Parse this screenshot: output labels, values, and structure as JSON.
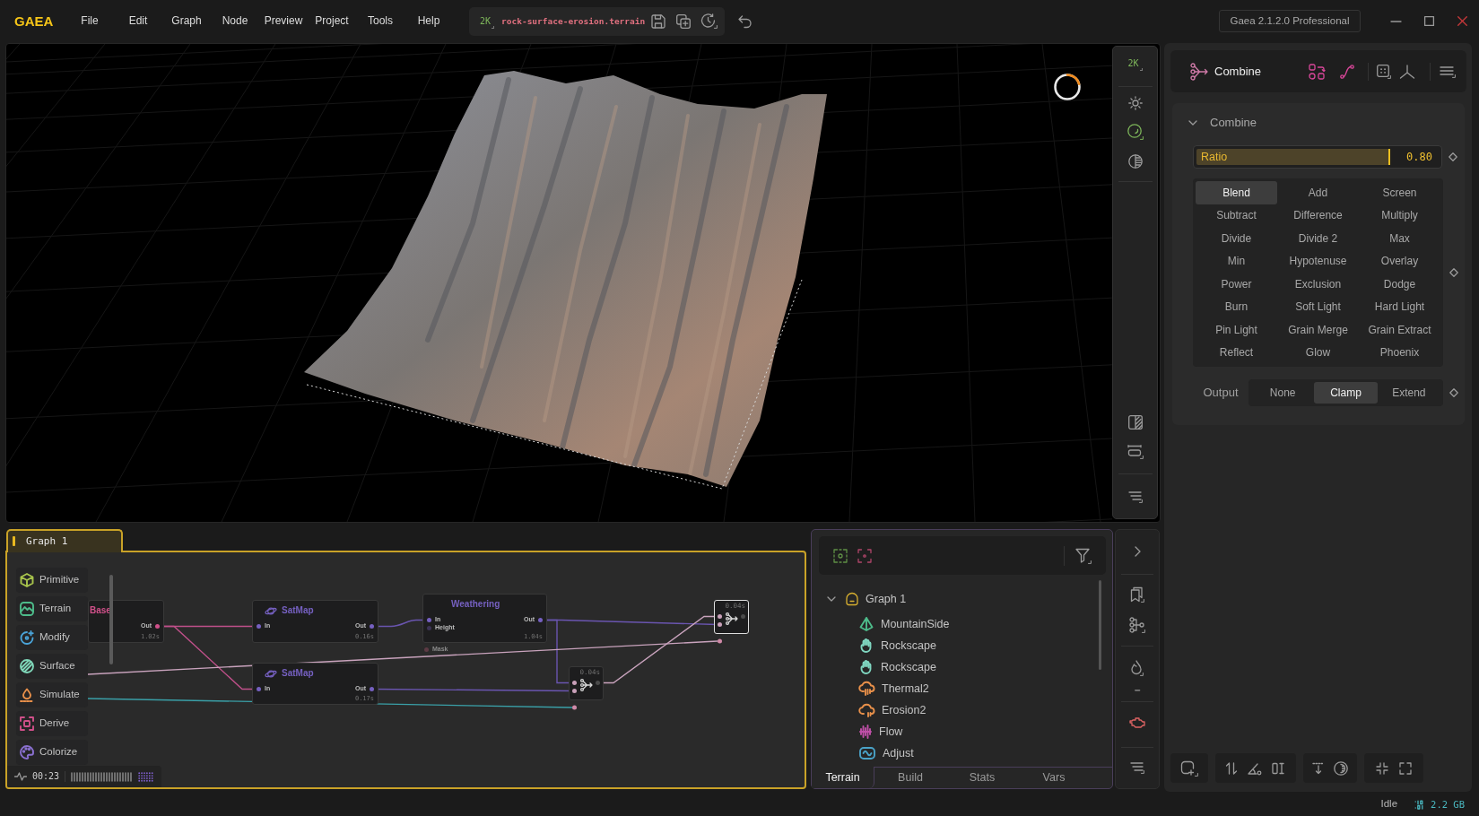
{
  "app": {
    "logo": "GAEA",
    "menu": [
      "File",
      "Edit",
      "Graph",
      "Node",
      "Preview",
      "Project",
      "Tools",
      "Help"
    ],
    "file": {
      "resolution": "2K",
      "name": "rock-surface-erosion.terrain"
    },
    "version": "Gaea 2.1.2.0 Professional"
  },
  "viewport": {
    "resolution": "2K",
    "toggles": [
      {
        "on": false
      },
      {
        "on": true
      },
      {
        "on": false
      }
    ]
  },
  "graph": {
    "tab": "Graph 1",
    "categories": [
      {
        "kind": "primitive",
        "label": "Primitive",
        "color": "#a8c44c"
      },
      {
        "kind": "terrain",
        "label": "Terrain",
        "color": "#4dbb8a"
      },
      {
        "kind": "modify",
        "label": "Modify",
        "color": "#4aa3d8"
      },
      {
        "kind": "surface",
        "label": "Surface",
        "color": "#7fd6b8"
      },
      {
        "kind": "simulate",
        "label": "Simulate",
        "color": "#e8904a"
      },
      {
        "kind": "derive",
        "label": "Derive",
        "color": "#d0508a"
      },
      {
        "kind": "colorize",
        "label": "Colorize",
        "color": "#8a70d0"
      }
    ],
    "nodes": [
      {
        "kind": "texture",
        "title": "Base",
        "color": "#d0508a",
        "outputs": [
          "Out"
        ],
        "time": "1.02s",
        "selected": false
      },
      {
        "kind": "satmap",
        "title": "SatMap",
        "color": "#7560c0",
        "inputs": [
          "In"
        ],
        "outputs": [
          "Out"
        ],
        "time": "0.16s",
        "selected": false
      },
      {
        "kind": "satmap",
        "title": "SatMap",
        "color": "#7560c0",
        "inputs": [
          "In"
        ],
        "outputs": [
          "Out"
        ],
        "time": "0.17s",
        "selected": false
      },
      {
        "kind": "weathering",
        "title": "Weathering",
        "color": "#7560c0",
        "inputs": [
          "In",
          "Height"
        ],
        "outputs": [
          "Out"
        ],
        "mask": "Mask",
        "time": "1.04s",
        "selected": false
      },
      {
        "kind": "combine",
        "time": "0.04s",
        "selected": false
      },
      {
        "kind": "combine",
        "time": "0.04s",
        "selected": true
      }
    ],
    "timer": "00:23"
  },
  "outline": {
    "tree": [
      {
        "label": "Graph 1",
        "expanded": true,
        "children": [
          {
            "kind": "mountainside",
            "label": "MountainSide",
            "color": "#4dbb8a"
          },
          {
            "kind": "rockscape",
            "label": "Rockscape",
            "color": "#7fd6c0"
          },
          {
            "kind": "rockscape",
            "label": "Rockscape",
            "color": "#7fd6c0"
          },
          {
            "kind": "thermal",
            "label": "Thermal2",
            "color": "#e8904a"
          },
          {
            "kind": "erosion",
            "label": "Erosion2",
            "color": "#e8904a"
          },
          {
            "kind": "flow",
            "label": "Flow",
            "color": "#c050a8"
          },
          {
            "kind": "adjust",
            "label": "Adjust",
            "color": "#4aa3c8"
          }
        ]
      }
    ],
    "tabs": [
      {
        "label": "Terrain",
        "selected": true
      },
      {
        "label": "Build",
        "selected": false
      },
      {
        "label": "Stats",
        "selected": false
      },
      {
        "label": "Vars",
        "selected": false
      }
    ]
  },
  "properties": {
    "title": "Combine",
    "section": {
      "title": "Combine",
      "expanded": true
    },
    "ratio": {
      "label": "Ratio",
      "level": 0.8,
      "reading": "0.80"
    },
    "modes": [
      {
        "label": "Blend",
        "selected": true
      },
      {
        "label": "Add",
        "selected": false
      },
      {
        "label": "Screen",
        "selected": false
      },
      {
        "label": "Subtract",
        "selected": false
      },
      {
        "label": "Difference",
        "selected": false
      },
      {
        "label": "Multiply",
        "selected": false
      },
      {
        "label": "Divide",
        "selected": false
      },
      {
        "label": "Divide 2",
        "selected": false
      },
      {
        "label": "Max",
        "selected": false
      },
      {
        "label": "Min",
        "selected": false
      },
      {
        "label": "Hypotenuse",
        "selected": false
      },
      {
        "label": "Overlay",
        "selected": false
      },
      {
        "label": "Power",
        "selected": false
      },
      {
        "label": "Exclusion",
        "selected": false
      },
      {
        "label": "Dodge",
        "selected": false
      },
      {
        "label": "Burn",
        "selected": false
      },
      {
        "label": "Soft Light",
        "selected": false
      },
      {
        "label": "Hard Light",
        "selected": false
      },
      {
        "label": "Pin Light",
        "selected": false
      },
      {
        "label": "Grain Merge",
        "selected": false
      },
      {
        "label": "Grain Extract",
        "selected": false
      },
      {
        "label": "Reflect",
        "selected": false
      },
      {
        "label": "Glow",
        "selected": false
      },
      {
        "label": "Phoenix",
        "selected": false
      }
    ],
    "output": {
      "label": "Output",
      "options": [
        {
          "label": "None",
          "selected": false
        },
        {
          "label": "Clamp",
          "selected": true
        },
        {
          "label": "Extend",
          "selected": false
        }
      ]
    }
  },
  "status": {
    "state": "Idle",
    "memory": "2.2 GB"
  }
}
